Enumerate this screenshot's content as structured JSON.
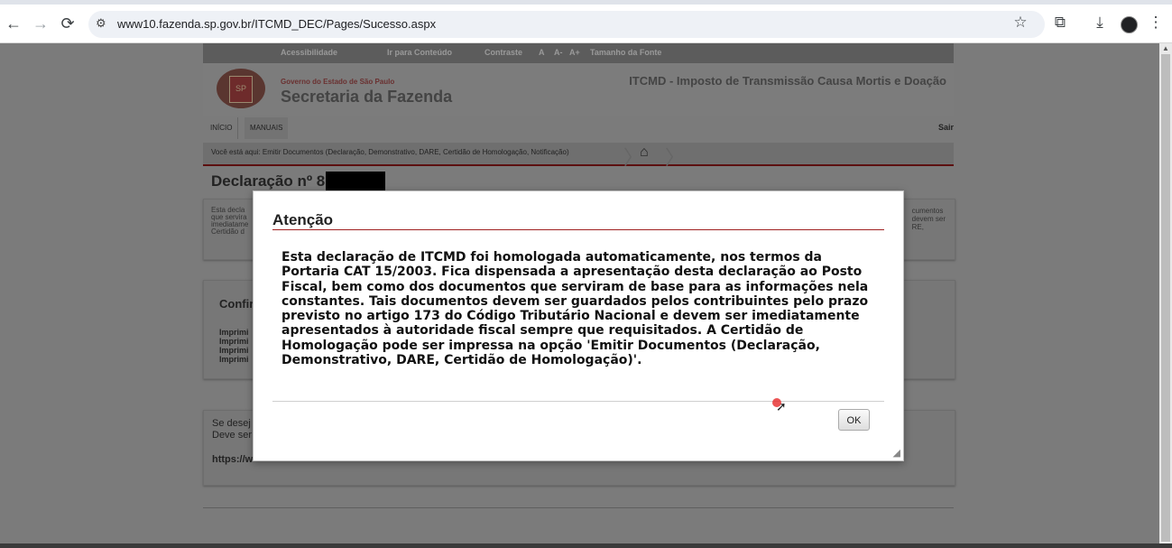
{
  "browser": {
    "url": "www10.fazenda.sp.gov.br/ITCMD_DEC/Pages/Sucesso.aspx",
    "back_icon": "←",
    "forward_icon": "→",
    "reload_icon": "⟳",
    "site_info_icon": "⚙",
    "star_icon": "☆",
    "extensions_icon": "⧉",
    "download_icon": "⤓",
    "menu_icon": "⋮"
  },
  "site": {
    "accessibility_bar": [
      "Acessibilidade",
      "Ir para Conteúdo",
      "Contraste",
      "A",
      "A-",
      "A+",
      "Tamanho da Fonte"
    ],
    "crest_label": "SP",
    "gov_line": "Governo do Estado de São Paulo",
    "secretaria": "Secretaria da Fazenda",
    "itcmd_title": "ITCMD - Imposto de Transmissão Causa Mortis e Doação",
    "menu": [
      "INÍCIO",
      "MANUAIS"
    ],
    "sair": "Sair",
    "breadcrumb": "Você está aqui: Emitir Documentos (Declaração, Demonstrativo, DARE, Certidão de Homologação, Notificação)",
    "home_icon": "⌂",
    "declaracao_title": "Declaração nº 8",
    "box1_left": [
      "Esta decla",
      "que servira",
      "imediatame",
      "Certidão d"
    ],
    "box1_right": [
      "cumentos",
      "devem ser",
      "RE,"
    ],
    "confir": "Confir",
    "imprimir": [
      "Imprimi",
      "Imprimi",
      "Imprimi",
      "Imprimi"
    ],
    "box3_lines": [
      "Se desej",
      "Deve ser"
    ],
    "box3_link": "https://w"
  },
  "modal": {
    "title": "Atenção",
    "message": "Esta declaração de ITCMD foi homologada automaticamente, nos termos da Portaria CAT 15/2003. Fica dispensada a apresentação desta declaração ao Posto Fiscal, bem como dos documentos que serviram de base para as informações nela constantes. Tais documentos devem ser guardados pelos contribuintes pelo prazo previsto no artigo 173 do Código Tributário Nacional e devem ser imediatamente apresentados à autoridade fiscal sempre que requisitados. A Certidão de Homologação pode ser impressa na opção 'Emitir Documentos (Declaração, Demonstrativo, DARE, Certidão de Homologação)'.",
    "ok_label": "OK"
  }
}
